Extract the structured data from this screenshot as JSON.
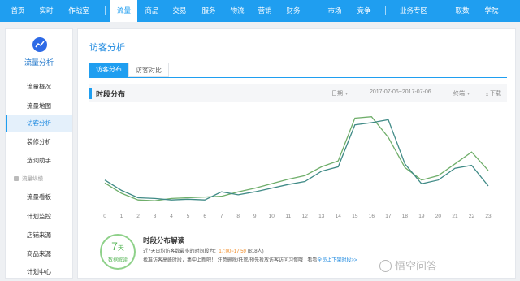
{
  "topnav": {
    "items": [
      {
        "label": "首页"
      },
      {
        "label": "实时"
      },
      {
        "label": "作战室"
      },
      {
        "label": "流量",
        "active": true
      },
      {
        "label": "商品"
      },
      {
        "label": "交易"
      },
      {
        "label": "服务"
      },
      {
        "label": "物流"
      },
      {
        "label": "营销"
      },
      {
        "label": "财务"
      },
      {
        "label": "市场"
      },
      {
        "label": "竞争"
      },
      {
        "label": "业务专区"
      },
      {
        "label": "取数"
      },
      {
        "label": "学院"
      }
    ]
  },
  "sidebar": {
    "title": "流量分析",
    "items": [
      {
        "label": "流量概况"
      },
      {
        "label": "流量地图"
      },
      {
        "label": "访客分析",
        "active": true
      },
      {
        "label": "装修分析"
      },
      {
        "label": "选词助手"
      }
    ],
    "group_label": "流量纵横",
    "group_items": [
      {
        "label": "流量看板"
      },
      {
        "label": "计划监控"
      },
      {
        "label": "店铺来源"
      },
      {
        "label": "商品来源"
      },
      {
        "label": "计划中心"
      }
    ]
  },
  "main": {
    "title": "访客分析",
    "tabs": [
      {
        "label": "访客分布",
        "active": true
      },
      {
        "label": "访客对比"
      }
    ],
    "chart_header": {
      "title": "时段分布",
      "period_select": "日期",
      "date_range": "2017-07-06~2017-07-06",
      "terminal_select": "终端",
      "download": "下载"
    },
    "insight": {
      "badge_number": "7",
      "badge_unit": "天",
      "badge_label": "数据解读",
      "title": "时段分布解读",
      "line1_prefix": "近7天日均访客数最多的时间段为：",
      "line1_highlight": "17:00~17:59",
      "line1_suffix": "(818人)",
      "line2_prefix": "找准访客高峰时段，集中上新吧！ 注意删除/托管/预先投放访客访问习惯哦 · 看看",
      "line2_link": "全员上下架时段>>"
    }
  },
  "watermark": "悟空问答",
  "colors": {
    "primary": "#1f9ef0",
    "series_a": "#6fae6a",
    "series_b": "#3f8a86",
    "badge": "#5cb85c",
    "highlight": "#f08a24"
  },
  "chart_data": {
    "type": "line",
    "x": [
      "0",
      "1",
      "2",
      "3",
      "4",
      "5",
      "6",
      "7",
      "8",
      "9",
      "10",
      "11",
      "12",
      "13",
      "14",
      "15",
      "16",
      "17",
      "18",
      "19",
      "20",
      "21",
      "22",
      "23"
    ],
    "series": [
      {
        "values": [
          36,
          22,
          13,
          12,
          15,
          16,
          17,
          18,
          24,
          29,
          35,
          41,
          46,
          58,
          66,
          124,
          126,
          98,
          57,
          40,
          46,
          62,
          78,
          53
        ]
      },
      {
        "values": [
          40,
          26,
          16,
          15,
          13,
          14,
          13,
          24,
          20,
          24,
          29,
          34,
          38,
          52,
          58,
          115,
          118,
          122,
          62,
          35,
          40,
          56,
          60,
          32
        ]
      }
    ],
    "ylim": [
      0,
      140
    ],
    "grid": false,
    "legend": "none"
  }
}
